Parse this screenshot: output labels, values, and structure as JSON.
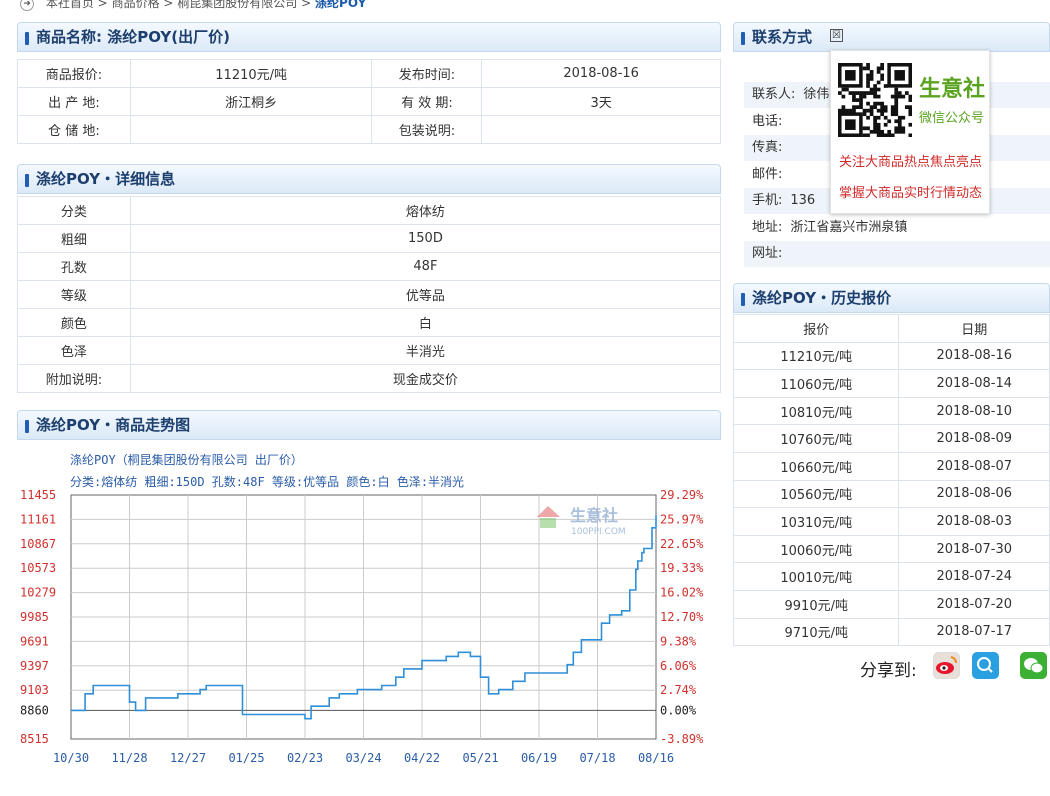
{
  "breadcrumb": {
    "home": "本社首页",
    "sep1": ">",
    "level2": "商品价格",
    "sep2": ">",
    "level3": "桐昆集团股份有限公司",
    "sep3": ">",
    "current": "涤纶POY"
  },
  "product": {
    "title": "商品名称: 涤纶POY(出厂价)",
    "rows": [
      {
        "l1": "商品报价:",
        "v1": "11210元/吨",
        "l2": "发布时间:",
        "v2": "2018-08-16"
      },
      {
        "l1": "出 产 地:",
        "v1": "浙江桐乡",
        "l2": "有 效 期:",
        "v2": "3天"
      },
      {
        "l1": "仓 储 地:",
        "v1": "",
        "l2": "包装说明:",
        "v2": ""
      }
    ]
  },
  "detail": {
    "title": "涤纶POY・详细信息",
    "rows": [
      {
        "label": "分类",
        "value": "熔体纺"
      },
      {
        "label": "粗细",
        "value": "150D"
      },
      {
        "label": "孔数",
        "value": "48F"
      },
      {
        "label": "等级",
        "value": "优等品"
      },
      {
        "label": "颜色",
        "value": "白"
      },
      {
        "label": "色泽",
        "value": "半消光"
      },
      {
        "label": "附加说明:",
        "value": "现金成交价"
      }
    ]
  },
  "trend": {
    "title": "涤纶POY・商品走势图",
    "subtitle1": "涤纶POY（桐昆集团股份有限公司 出厂价）",
    "subtitle2": "分类:熔体纺 粗细:150D 孔数:48F 等级:优等品 颜色:白 色泽:半消光",
    "watermark_cn": "生意社",
    "watermark_en": "100PPI.COM"
  },
  "chart_data": {
    "type": "line",
    "x_ticks": [
      "10/30",
      "11/28",
      "12/27",
      "01/25",
      "02/23",
      "03/24",
      "04/22",
      "05/21",
      "06/19",
      "07/18",
      "08/16"
    ],
    "y_ticks_left": [
      "11455",
      "11161",
      "10867",
      "10573",
      "10279",
      "9985",
      "9691",
      "9397",
      "9103",
      "8860",
      "8515"
    ],
    "y_ticks_right": [
      "29.29%",
      "25.97%",
      "22.65%",
      "19.33%",
      "16.02%",
      "12.70%",
      "9.38%",
      "6.06%",
      "2.74%",
      "0.00%",
      "-3.89%"
    ],
    "ylim": [
      8515,
      11455
    ],
    "baseline": 8860,
    "series": [
      {
        "x": [
          "2017-10-30",
          "2017-11-06",
          "2017-11-10",
          "2017-11-20",
          "2017-11-28",
          "2017-12-01",
          "2017-12-06",
          "2017-12-15",
          "2017-12-22",
          "2017-12-27",
          "2018-01-02",
          "2018-01-05",
          "2018-01-08",
          "2018-01-15",
          "2018-01-18",
          "2018-01-23",
          "2018-01-25",
          "2018-02-01",
          "2018-02-12",
          "2018-02-23",
          "2018-02-26",
          "2018-03-02",
          "2018-03-07",
          "2018-03-12",
          "2018-03-16",
          "2018-03-21",
          "2018-03-26",
          "2018-04-02",
          "2018-04-09",
          "2018-04-13",
          "2018-04-17",
          "2018-04-22",
          "2018-04-30",
          "2018-05-04",
          "2018-05-10",
          "2018-05-16",
          "2018-05-21",
          "2018-05-25",
          "2018-05-30",
          "2018-06-06",
          "2018-06-12",
          "2018-06-18",
          "2018-06-22",
          "2018-06-28",
          "2018-07-03",
          "2018-07-06",
          "2018-07-10",
          "2018-07-13",
          "2018-07-17",
          "2018-07-20",
          "2018-07-24",
          "2018-07-30",
          "2018-08-03",
          "2018-08-06",
          "2018-08-07",
          "2018-08-09",
          "2018-08-10",
          "2018-08-14",
          "2018-08-16"
        ],
        "y": [
          8860,
          9060,
          9160,
          9160,
          8960,
          8860,
          9010,
          9010,
          9060,
          9060,
          9110,
          9160,
          9160,
          9160,
          9160,
          8810,
          8810,
          8810,
          8810,
          8760,
          8910,
          8910,
          9010,
          9060,
          9060,
          9110,
          9110,
          9160,
          9260,
          9360,
          9360,
          9460,
          9460,
          9510,
          9560,
          9510,
          9260,
          9060,
          9110,
          9210,
          9310,
          9310,
          9310,
          9310,
          9410,
          9560,
          9710,
          9710,
          9710,
          9910,
          10010,
          10060,
          10310,
          10560,
          10660,
          10760,
          10810,
          11060,
          11210
        ]
      }
    ]
  },
  "contact": {
    "title": "联系方式",
    "rows": [
      {
        "label": "联系人:",
        "value": "徐伟"
      },
      {
        "label": "电话:",
        "value": ""
      },
      {
        "label": "传真:",
        "value": ""
      },
      {
        "label": "邮件:",
        "value": ""
      },
      {
        "label": "手机:",
        "value": "136"
      },
      {
        "label": "地址:",
        "value": "浙江省嘉兴市洲泉镇"
      },
      {
        "label": "网址:",
        "value": ""
      }
    ]
  },
  "popup": {
    "brand": "生意社",
    "brand_sub": "微信公众号",
    "line1": "关注大商品热点焦点亮点",
    "line2": "掌握大商品实时行情动态",
    "close_glyph": "☒"
  },
  "history": {
    "title": "涤纶POY・历史报价",
    "col_price": "报价",
    "col_date": "日期",
    "rows": [
      {
        "price": "11210元/吨",
        "date": "2018-08-16"
      },
      {
        "price": "11060元/吨",
        "date": "2018-08-14"
      },
      {
        "price": "10810元/吨",
        "date": "2018-08-10"
      },
      {
        "price": "10760元/吨",
        "date": "2018-08-09"
      },
      {
        "price": "10660元/吨",
        "date": "2018-08-07"
      },
      {
        "price": "10560元/吨",
        "date": "2018-08-06"
      },
      {
        "price": "10310元/吨",
        "date": "2018-08-03"
      },
      {
        "price": "10060元/吨",
        "date": "2018-07-30"
      },
      {
        "price": "10010元/吨",
        "date": "2018-07-24"
      },
      {
        "price": "9910元/吨",
        "date": "2018-07-20"
      },
      {
        "price": "9710元/吨",
        "date": "2018-07-17"
      }
    ]
  },
  "share": {
    "label": "分享到:",
    "icons": [
      "weibo-icon",
      "qzone-icon",
      "wechat-icon"
    ]
  },
  "colors": {
    "accent": "#1e5fb5",
    "line": "#2f8fd8",
    "chart_text": "#2a5ca8",
    "axis_red": "#d0312d"
  }
}
